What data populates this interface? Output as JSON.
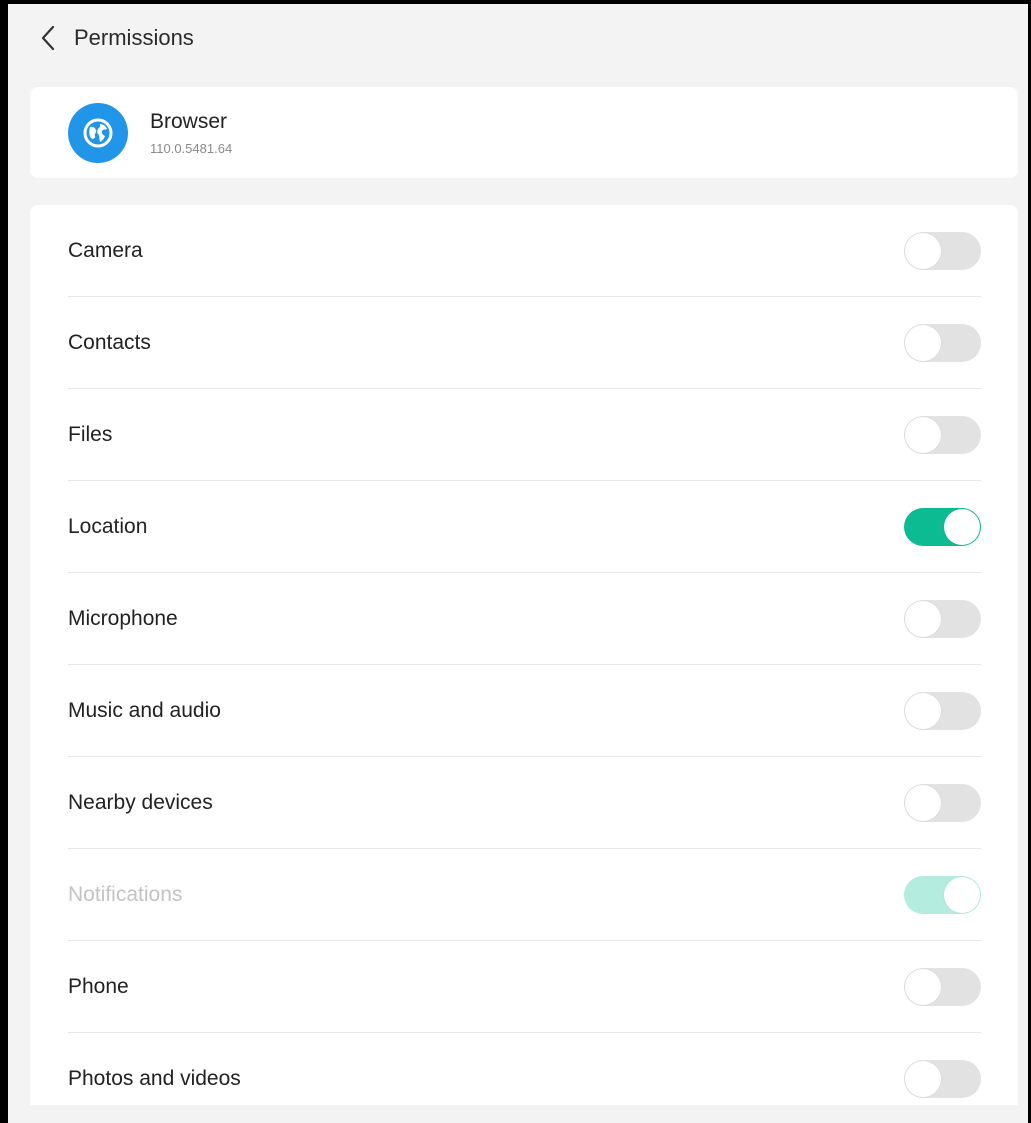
{
  "header": {
    "title": "Permissions",
    "back_icon": "chevron-left-icon"
  },
  "app": {
    "name": "Browser",
    "version": "110.0.5481.64",
    "icon": "globe-icon",
    "icon_color": "#2196e8"
  },
  "colors": {
    "toggle_on": "#0dbb93",
    "toggle_on_disabled": "#b4ece0",
    "toggle_off": "#e2e2e2"
  },
  "permissions": [
    {
      "label": "Camera",
      "enabled": false,
      "disabled": false
    },
    {
      "label": "Contacts",
      "enabled": false,
      "disabled": false
    },
    {
      "label": "Files",
      "enabled": false,
      "disabled": false
    },
    {
      "label": "Location",
      "enabled": true,
      "disabled": false
    },
    {
      "label": "Microphone",
      "enabled": false,
      "disabled": false
    },
    {
      "label": "Music and audio",
      "enabled": false,
      "disabled": false
    },
    {
      "label": "Nearby devices",
      "enabled": false,
      "disabled": false
    },
    {
      "label": "Notifications",
      "enabled": true,
      "disabled": true
    },
    {
      "label": "Phone",
      "enabled": false,
      "disabled": false
    },
    {
      "label": "Photos and videos",
      "enabled": false,
      "disabled": false
    }
  ]
}
